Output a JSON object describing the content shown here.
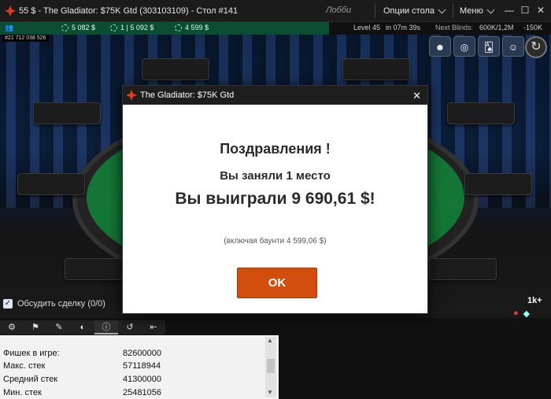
{
  "window": {
    "title": "55 $ - The Gladiator: $75K Gtd  (303103109) - Стол #141",
    "lobby": "Лобби",
    "menu_table": "Опции стола",
    "menu_main": "Меню"
  },
  "infobar": {
    "stack_left": "5 082 $",
    "stack_mid": "1 | 5 092 $",
    "stack_right": "4 599 $",
    "level": "Level 45",
    "next_time": "in 07m 39s",
    "next_blinds_label": "Next Blinds:",
    "next_blinds_value": "600K/1,2M",
    "ante": "-150K"
  },
  "tournament_id": "#21 712 038 526",
  "discuss": {
    "label": "Обсудить сделку (0/0)"
  },
  "bottom_right": {
    "badge": "1k+"
  },
  "stats": [
    {
      "label": "Фишек в игре:",
      "value": "82600000"
    },
    {
      "label": "Макс. стек",
      "value": "57118944"
    },
    {
      "label": "Средний стек",
      "value": "41300000"
    },
    {
      "label": "Мин. стек",
      "value": "25481056"
    }
  ],
  "dialog": {
    "title": "The Gladiator: $75K Gtd",
    "congrats": "Поздравления !",
    "place": "Вы заняли 1 место",
    "won": "Вы выиграли 9 690,61 $!",
    "bounty": "(включая баунти 4 599,06 $)",
    "ok": "OK"
  }
}
